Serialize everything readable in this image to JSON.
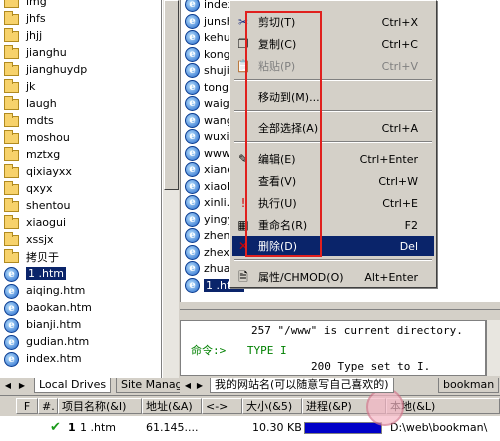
{
  "left_tree": {
    "items": [
      {
        "label": "img",
        "icon": "folder-icon"
      },
      {
        "label": "jhfs",
        "icon": "folder-icon"
      },
      {
        "label": "jhjj",
        "icon": "folder-icon"
      },
      {
        "label": "jianghu",
        "icon": "folder-icon"
      },
      {
        "label": "jianghuydp",
        "icon": "folder-icon"
      },
      {
        "label": "jk",
        "icon": "folder-icon"
      },
      {
        "label": "laugh",
        "icon": "folder-icon"
      },
      {
        "label": "mdts",
        "icon": "folder-icon"
      },
      {
        "label": "moshou",
        "icon": "folder-icon"
      },
      {
        "label": "mztxg",
        "icon": "folder-icon"
      },
      {
        "label": "qixiayxx",
        "icon": "folder-icon"
      },
      {
        "label": "qxyx",
        "icon": "folder-icon"
      },
      {
        "label": "shentou",
        "icon": "folder-icon"
      },
      {
        "label": "xiaogui",
        "icon": "folder-icon"
      },
      {
        "label": "xssjx",
        "icon": "folder-icon"
      },
      {
        "label": "拷贝于",
        "icon": "folder-icon"
      },
      {
        "label": "1 .htm",
        "icon": "ie-file-icon",
        "selected": true
      },
      {
        "label": "aiqing.htm",
        "icon": "ie-file-icon"
      },
      {
        "label": "baokan.htm",
        "icon": "ie-file-icon"
      },
      {
        "label": "bianji.htm",
        "icon": "ie-file-icon"
      },
      {
        "label": "gudian.htm",
        "icon": "ie-file-icon"
      },
      {
        "label": "index.htm",
        "icon": "ie-file-icon"
      }
    ]
  },
  "right_list": {
    "items": [
      {
        "label": "index"
      },
      {
        "label": "junsh"
      },
      {
        "label": "kehuc"
      },
      {
        "label": "kong."
      },
      {
        "label": "shuji."
      },
      {
        "label": "tongx"
      },
      {
        "label": "waigu"
      },
      {
        "label": "wangx"
      },
      {
        "label": "wuxia"
      },
      {
        "label": "www"
      },
      {
        "label": "xianc"
      },
      {
        "label": "xiaoh"
      },
      {
        "label": "xinli."
      },
      {
        "label": "yingy"
      },
      {
        "label": "zhenl"
      },
      {
        "label": "zhexu"
      },
      {
        "label": "zhuan"
      },
      {
        "label": "1 .htm",
        "selected": true
      }
    ]
  },
  "context_menu": {
    "items": [
      {
        "label": "剪切(T)",
        "shortcut": "Ctrl+X",
        "icon": "scissors-icon"
      },
      {
        "label": "复制(C)",
        "shortcut": "Ctrl+C",
        "icon": "copy-icon"
      },
      {
        "label": "粘贴(P)",
        "shortcut": "Ctrl+V",
        "icon": "paste-icon",
        "disabled": true
      },
      {
        "label": "移动到(M)...",
        "shortcut": "",
        "icon": ""
      },
      {
        "label": "全部选择(A)",
        "shortcut": "Ctrl+A",
        "icon": ""
      },
      {
        "label": "编辑(E)",
        "shortcut": "Ctrl+Enter",
        "icon": "edit-icon"
      },
      {
        "label": "查看(V)",
        "shortcut": "Ctrl+W",
        "icon": ""
      },
      {
        "label": "执行(U)",
        "shortcut": "Ctrl+E",
        "icon": "exclamation-icon"
      },
      {
        "label": "重命名(R)",
        "shortcut": "F2",
        "icon": "rename-icon"
      },
      {
        "label": "删除(D)",
        "shortcut": "Del",
        "icon": "delete-icon",
        "highlighted": true
      },
      {
        "label": "属性/CHMOD(O)",
        "shortcut": "Alt+Enter",
        "icon": "properties-icon"
      }
    ]
  },
  "log": {
    "line1": "257 \"/www\" is current directory.",
    "cmd_prefix": "命令:>",
    "cmd": "TYPE I",
    "line3": "200 Type set to I."
  },
  "tabs": {
    "left": [
      "Local Drives",
      "Site Manage"
    ],
    "right": [
      "我的网站名(可以随意写自己喜欢的)",
      "bookman"
    ]
  },
  "queue": {
    "headers": [
      "#.",
      "项目名称(&I)",
      "地址(&A)",
      "<->",
      "大小(&5)",
      "进程(&P)",
      "本地(&L)"
    ],
    "row": {
      "num": "1",
      "name": "1 .htm",
      "address": "61.145....",
      "size": "10.30 KB",
      "progress": 1.0,
      "progress_text": "100%",
      "local": "D:\\web\\bookman\\"
    },
    "status_label": "F"
  },
  "colors": {
    "selection": "#0a246a",
    "annotation_box": "#e0201e",
    "log_cmd": "#008000"
  }
}
